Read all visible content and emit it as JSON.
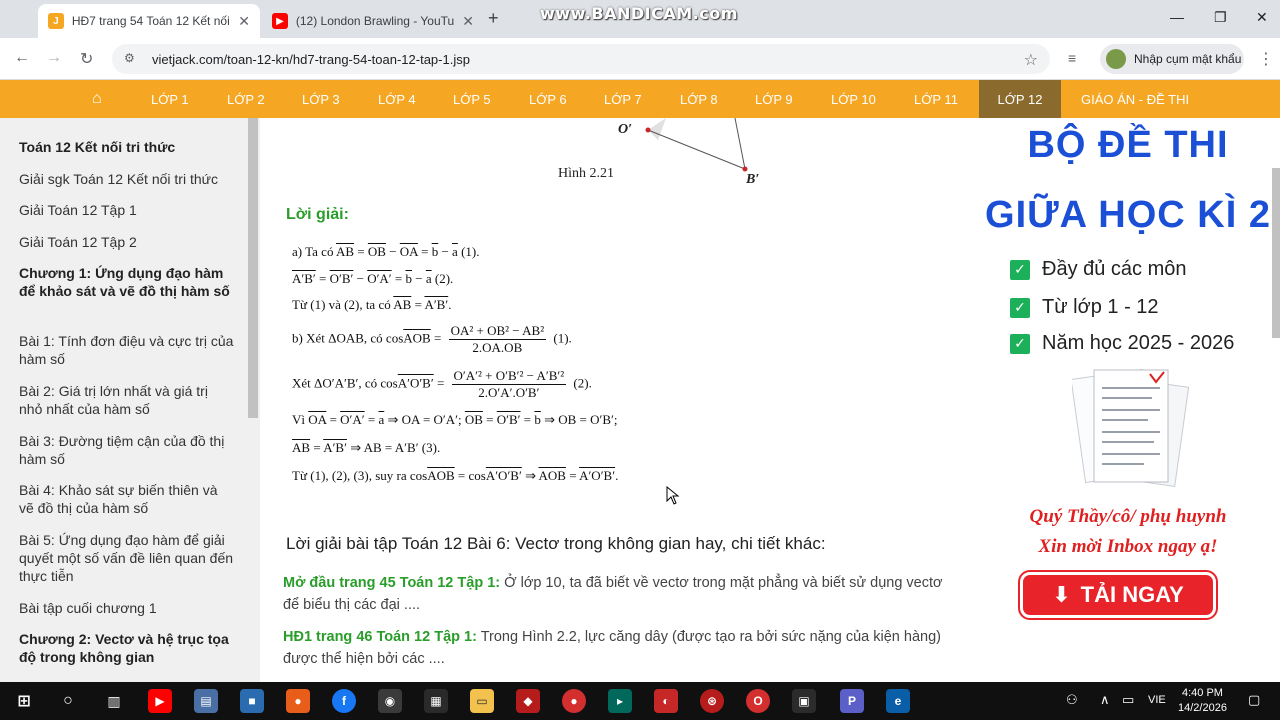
{
  "watermark": "www.BANDICAM.com",
  "tabs": [
    {
      "title": "HĐ7 trang 54 Toán 12 Kết nối t",
      "favicon": "J",
      "color": "#f5a623",
      "active": true
    },
    {
      "title": "(12) London Brawling - YouTub",
      "favicon": "▶",
      "color": "#ff0000",
      "active": false
    }
  ],
  "url": "vietjack.com/toan-12-kn/hd7-trang-54-toan-12-tap-1.jsp",
  "profile_label": "Nhập cụm mật khẩu",
  "nav": [
    "LỚP 1",
    "LỚP 2",
    "LỚP 3",
    "LỚP 4",
    "LỚP 5",
    "LỚP 6",
    "LỚP 7",
    "LỚP 8",
    "LỚP 9",
    "LỚP 10",
    "LỚP 11",
    "LỚP 12",
    "GIÁO ÁN - ĐỀ THI"
  ],
  "sidebar": [
    {
      "text": "Toán 12 Kết nối tri thức",
      "bold": true
    },
    {
      "text": "Giải sgk Toán 12 Kết nối tri thức",
      "bold": false
    },
    {
      "text": "Giải Toán 12 Tập 1",
      "bold": false
    },
    {
      "text": "Giải Toán 12 Tập 2",
      "bold": false
    },
    {
      "text": "Chương 1: Ứng dụng đạo hàm để khảo sát và vẽ đồ thị hàm số",
      "bold": true
    },
    {
      "text": "Bài 1: Tính đơn điệu và cực trị của hàm số",
      "bold": false
    },
    {
      "text": "Bài 2: Giá trị lớn nhất và giá trị nhỏ nhất của hàm số",
      "bold": false
    },
    {
      "text": "Bài 3: Đường tiệm cận của đồ thị hàm số",
      "bold": false
    },
    {
      "text": "Bài 4: Khảo sát sự biến thiên và vẽ đồ thị của hàm số",
      "bold": false
    },
    {
      "text": "Bài 5: Ứng dụng đạo hàm để giải quyết một số vấn đề liên quan đến thực tiễn",
      "bold": false
    },
    {
      "text": "Bài tập cuối chương 1",
      "bold": false
    },
    {
      "text": "Chương 2: Vectơ và hệ trục tọa độ trong không gian",
      "bold": true
    }
  ],
  "figure": {
    "caption": "Hình 2.21",
    "o_label": "O′",
    "b_label": "B′"
  },
  "solution_title": "Lời giải:",
  "math": {
    "l1_a": "a) Ta có ",
    "l1_b": "AB",
    "l1_c": " = ",
    "l1_d": "OB",
    "l1_e": " − ",
    "l1_f": "OA",
    "l1_g": " = ",
    "l1_h": "b",
    "l1_i": " − ",
    "l1_j": "a",
    "l1_k": " (1).",
    "l2_a": "A′B′",
    "l2_b": " = ",
    "l2_c": "O′B′",
    "l2_d": " − ",
    "l2_e": "O′A′",
    "l2_f": " = ",
    "l2_g": "b",
    "l2_h": " − ",
    "l2_i": "a",
    "l2_j": " (2).",
    "l3_a": "Từ (1) và (2), ta có ",
    "l3_b": "AB",
    "l3_c": " = ",
    "l3_d": "A′B′",
    "l3_e": ".",
    "l4_a": "b) Xét ΔOAB, có cos",
    "l4_b": "AOB",
    "l4_c": " = ",
    "l4_num": "OA² + OB² − AB²",
    "l4_den": "2.OA.OB",
    "l4_d": " (1).",
    "l5_a": "Xét ΔO′A′B′, có cos",
    "l5_b": "A′O′B′",
    "l5_c": " = ",
    "l5_num": "O′A′² + O′B′² − A′B′²",
    "l5_den": "2.O′A′.O′B′",
    "l5_d": " (2).",
    "l6_a": "Vì ",
    "l6_b": "OA",
    "l6_c": " = ",
    "l6_d": "O′A′",
    "l6_e": " = ",
    "l6_f": "a",
    "l6_g": " ⇒ OA = O′A′; ",
    "l6_h": "OB",
    "l6_i": " = ",
    "l6_j": "O′B′",
    "l6_k": " = ",
    "l6_l": "b",
    "l6_m": " ⇒ OB = O′B′;",
    "l7_a": "AB",
    "l7_b": " = ",
    "l7_c": "A′B′",
    "l7_d": " ⇒ AB = A′B′ (3).",
    "l8_a": "Từ (1), (2), (3), suy ra cos",
    "l8_b": "AOB",
    "l8_c": " = cos",
    "l8_d": "A′O′B′",
    "l8_e": " ⇒ ",
    "l8_f": "AOB",
    "l8_g": " = ",
    "l8_h": "A′O′B′",
    "l8_i": "."
  },
  "related_title": "Lời giải bài tập Toán 12 Bài 6: Vectơ trong không gian hay, chi tiết khác:",
  "related": [
    {
      "label": "Mở đầu trang 45 Toán 12 Tập 1:",
      "text": " Ở lớp 10, ta đã biết về vectơ trong mặt phẳng và biết sử dụng vectơ để biểu thị các đại ...."
    },
    {
      "label": "HĐ1 trang 46 Toán 12 Tập 1:",
      "text": " Trong Hình 2.2, lực căng dây (được tạo ra bởi sức nặng của kiện hàng) được thể hiện bởi các ...."
    }
  ],
  "ad": {
    "line1": "BỘ ĐỀ THI",
    "line2": "GIỮA HỌC KÌ 2",
    "checks": [
      "Đầy đủ các môn",
      "Từ lớp 1 - 12",
      "Năm học 2025 - 2026"
    ],
    "promo1": "Quý Thầy/cô/ phụ huynh",
    "promo2": "Xin mời Inbox ngay ạ!",
    "button": "TẢI NGAY"
  },
  "taskbar": {
    "lang": "VIE",
    "time": "4:40 PM",
    "date": "14/2/2026"
  }
}
